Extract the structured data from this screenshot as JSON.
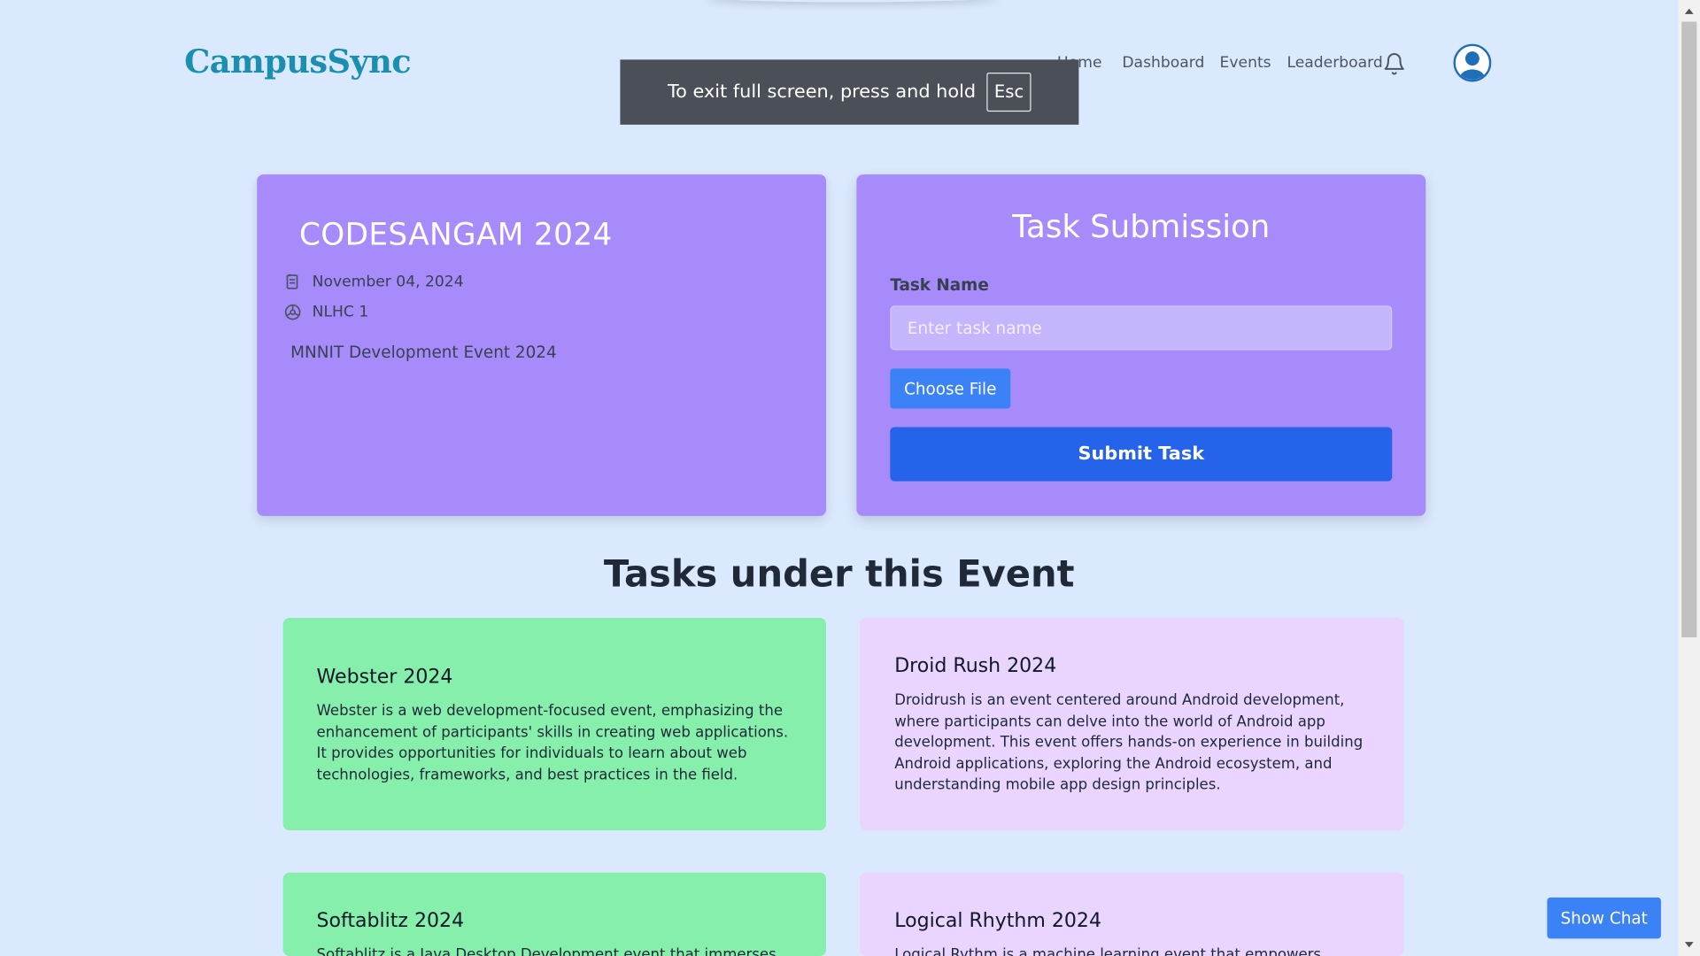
{
  "app": {
    "brand": "CampusSync"
  },
  "nav": {
    "items": [
      "Home",
      "Dashboard",
      "Events",
      "Leaderboard"
    ]
  },
  "fullscreen_notice": {
    "text": "To exit full screen, press and hold",
    "key": "Esc"
  },
  "event": {
    "title": "CODESANGAM 2024",
    "date": "November 04, 2024",
    "venue": "NLHC 1",
    "description": "MNNIT Development Event 2024"
  },
  "submission": {
    "title": "Task Submission",
    "field_label": "Task Name",
    "placeholder": "Enter task name",
    "choose_file": "Choose File",
    "submit": "Submit Task"
  },
  "tasks_heading": "Tasks under this Event",
  "tasks": [
    {
      "title": "Webster 2024",
      "description": "Webster is a web development-focused event, emphasizing the enhancement of participants' skills in creating web applications. It provides opportunities for individuals to learn about web technologies, frameworks, and best practices in the field."
    },
    {
      "title": "Droid Rush 2024",
      "description": "Droidrush is an event centered around Android development, where participants can delve into the world of Android app development. This event offers hands-on experience in building Android applications, exploring the Android ecosystem, and understanding mobile app design principles."
    },
    {
      "title": "Softablitz 2024",
      "description": "Softablitz is a Java Desktop Development event that immerses"
    },
    {
      "title": "Logical Rhythm 2024",
      "description": "Logical Rythm is a machine learning event that empowers participants"
    }
  ],
  "chat": {
    "button": "Show Chat"
  },
  "colors": {
    "background": "#dbe9ff",
    "brand": "#1b8fb0",
    "card_purple": "#a78bfa",
    "task_green": "#86efac",
    "task_lavender": "#e9d5ff",
    "primary_button": "#2563eb",
    "secondary_button": "#3b82f6"
  }
}
